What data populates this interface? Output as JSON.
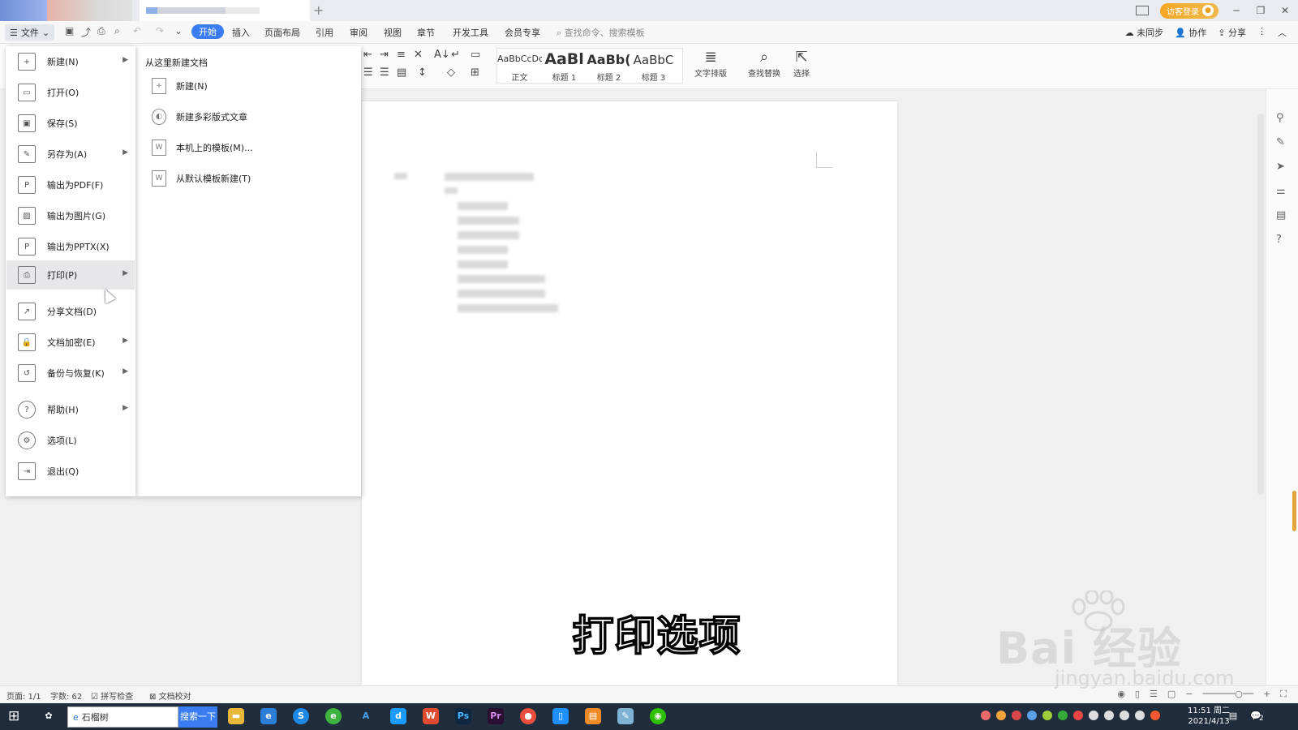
{
  "titlebar": {
    "visitor_login": "访客登录"
  },
  "menubar": {
    "file_label": "文件",
    "tabs": [
      "开始",
      "插入",
      "页面布局",
      "引用",
      "审阅",
      "视图",
      "章节",
      "开发工具",
      "会员专享"
    ],
    "active_tab": "开始",
    "search_placeholder": "查找命令、搜索模板",
    "right_actions": [
      "未同步",
      "协作",
      "分享"
    ]
  },
  "ribbon": {
    "styles": [
      {
        "sample": "AaBbCcDc",
        "label": "正文"
      },
      {
        "sample": "AaBl",
        "label": "标题 1"
      },
      {
        "sample": "AaBb(",
        "label": "标题 2"
      },
      {
        "sample": "AaBbC",
        "label": "标题 3"
      }
    ],
    "text_layout": "文字排版",
    "find_replace": "查找替换",
    "select": "选择"
  },
  "file_menu": {
    "items": [
      {
        "label": "新建(N)",
        "icon": "new-doc-icon",
        "has_sub": true
      },
      {
        "label": "打开(O)",
        "icon": "folder-icon",
        "has_sub": false
      },
      {
        "label": "保存(S)",
        "icon": "save-icon",
        "has_sub": false
      },
      {
        "label": "另存为(A)",
        "icon": "save-as-icon",
        "has_sub": true
      },
      {
        "label": "输出为PDF(F)",
        "icon": "pdf-icon",
        "has_sub": false
      },
      {
        "label": "输出为图片(G)",
        "icon": "image-icon",
        "has_sub": false
      },
      {
        "label": "输出为PPTX(X)",
        "icon": "pptx-icon",
        "has_sub": false
      },
      {
        "label": "打印(P)",
        "icon": "print-icon",
        "has_sub": true
      },
      {
        "label": "分享文档(D)",
        "icon": "share-icon",
        "has_sub": false
      },
      {
        "label": "文档加密(E)",
        "icon": "lock-doc-icon",
        "has_sub": true
      },
      {
        "label": "备份与恢复(K)",
        "icon": "backup-icon",
        "has_sub": true
      },
      {
        "label": "帮助(H)",
        "icon": "help-icon",
        "has_sub": true
      },
      {
        "label": "选项(L)",
        "icon": "gear-icon",
        "has_sub": false
      },
      {
        "label": "退出(Q)",
        "icon": "exit-icon",
        "has_sub": false
      }
    ],
    "highlighted": "打印(P)"
  },
  "submenu": {
    "title": "从这里新建文档",
    "items": [
      "新建(N)",
      "新建多彩版式文章",
      "本机上的模板(M)...",
      "从默认模板新建(T)"
    ]
  },
  "statusbar": {
    "page": "页面: 1/1",
    "word_count": "字数: 62",
    "spell_check": "拼写检查",
    "doc_proof": "文档校对"
  },
  "taskbar": {
    "search_text": "石榴树",
    "search_button": "搜索一下",
    "time": "11:51 周二",
    "date": "2021/4/13",
    "notification_count": "2"
  },
  "overlay": {
    "caption": "打印选项",
    "watermark": "Bai 经验",
    "watermark_url": "jingyan.baidu.com"
  }
}
